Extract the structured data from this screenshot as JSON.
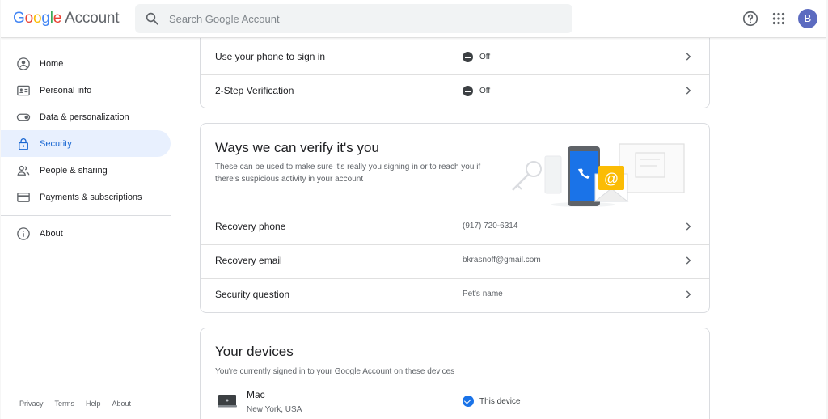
{
  "header": {
    "logo_letters": [
      "G",
      "o",
      "o",
      "g",
      "l",
      "e"
    ],
    "product": "Account",
    "search_placeholder": "Search Google Account",
    "avatar_letter": "B"
  },
  "sidebar": {
    "items": [
      {
        "label": "Home",
        "icon": "home-icon"
      },
      {
        "label": "Personal info",
        "icon": "id-card-icon"
      },
      {
        "label": "Data & personalization",
        "icon": "toggle-icon"
      },
      {
        "label": "Security",
        "icon": "lock-icon"
      },
      {
        "label": "People & sharing",
        "icon": "people-icon"
      },
      {
        "label": "Payments & subscriptions",
        "icon": "credit-card-icon"
      }
    ],
    "about": {
      "label": "About",
      "icon": "info-icon"
    },
    "footer": [
      "Privacy",
      "Terms",
      "Help",
      "About"
    ]
  },
  "signin_card": {
    "rows": [
      {
        "label": "Use your phone to sign in",
        "value": "Off"
      },
      {
        "label": "2-Step Verification",
        "value": "Off"
      }
    ]
  },
  "verify_card": {
    "title": "Ways we can verify it's you",
    "description": "These can be used to make sure it's really you signing in or to reach you if there's suspicious activity in your account",
    "rows": [
      {
        "label": "Recovery phone",
        "value": "(917) 720-6314"
      },
      {
        "label": "Recovery email",
        "value": "bkrasnoff@gmail.com"
      },
      {
        "label": "Security question",
        "value": "Pet's name"
      }
    ]
  },
  "devices_card": {
    "title": "Your devices",
    "description": "You're currently signed in to your Google Account on these devices",
    "device": {
      "name": "Mac",
      "location": "New York, USA",
      "status": "This device"
    }
  },
  "colors": {
    "accent": "#1a73e8",
    "active_bg": "#e8f0fe",
    "active_text": "#1967d2",
    "avatar": "#5c6bc0"
  }
}
